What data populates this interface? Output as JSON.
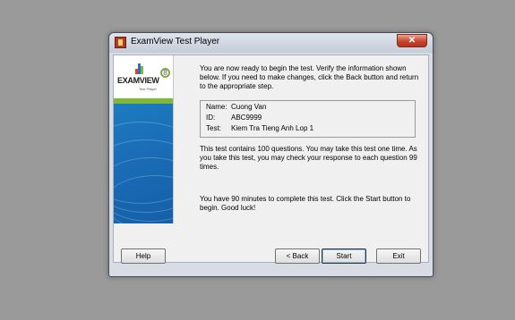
{
  "window": {
    "title": "ExamView Test Player",
    "close_icon": "close-icon"
  },
  "logo": {
    "text": "EXAMVIEW",
    "number": "8",
    "subtitle": "Test Player",
    "colors": {
      "green": "#7fb83b",
      "blue": "#1a6cb6"
    }
  },
  "intro_text": "You are now ready to begin the test.  Verify the information shown below.  If you need to make changes, click the Back button and return to the appropriate step.",
  "info": [
    {
      "label": "Name:",
      "value": "Cuong Van"
    },
    {
      "label": "ID:",
      "value": "ABC9999"
    },
    {
      "label": "Test:",
      "value": "Kiem Tra Tieng Anh Lop 1"
    }
  ],
  "questions_text": "This test contains 100 questions.  You may take this test one time.  As you take this test, you may check your response to each question 99 times.",
  "time_text": "You have 90 minutes to complete this test.  Click the Start button to begin.  Good luck!",
  "buttons": {
    "help": "Help",
    "back": "< Back",
    "start": "Start",
    "exit": "Exit"
  }
}
